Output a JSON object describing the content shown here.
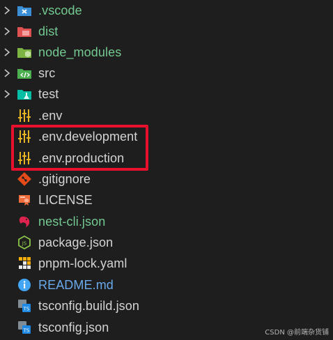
{
  "explorer": {
    "items": [
      {
        "label": "vscode",
        "prefix": ".",
        "kind": "folder",
        "icon": "vscode-folder-icon",
        "color": "#73c991"
      },
      {
        "label": "dist",
        "kind": "folder",
        "icon": "dist-folder-icon",
        "color": "#73c991"
      },
      {
        "label": "node_modules",
        "kind": "folder",
        "icon": "node-modules-folder-icon",
        "color": "#73c991"
      },
      {
        "label": "src",
        "kind": "folder",
        "icon": "src-folder-icon",
        "color": "#d4d4d4"
      },
      {
        "label": "test",
        "kind": "folder",
        "icon": "test-folder-icon",
        "color": "#d4d4d4"
      },
      {
        "label": ".env",
        "kind": "file",
        "icon": "env-settings-icon",
        "color": "#d4d4d4"
      },
      {
        "label": ".env.development",
        "kind": "file",
        "icon": "env-settings-icon",
        "color": "#d4d4d4"
      },
      {
        "label": ".env.production",
        "kind": "file",
        "icon": "env-settings-icon",
        "color": "#d4d4d4"
      },
      {
        "label": ".gitignore",
        "kind": "file",
        "icon": "git-icon",
        "color": "#d4d4d4"
      },
      {
        "label": "LICENSE",
        "kind": "file",
        "icon": "license-icon",
        "color": "#d4d4d4"
      },
      {
        "label": "nest-cli.json",
        "kind": "file",
        "icon": "nestjs-icon",
        "color": "#73c991"
      },
      {
        "label": "package.json",
        "kind": "file",
        "icon": "nodejs-icon",
        "color": "#d4d4d4"
      },
      {
        "label": "pnpm-lock.yaml",
        "kind": "file",
        "icon": "pnpm-icon",
        "color": "#d4d4d4"
      },
      {
        "label": "README.md",
        "kind": "file",
        "icon": "info-icon",
        "color": "#6aa9ea"
      },
      {
        "label": "tsconfig.build.json",
        "kind": "file",
        "icon": "tsconfig-icon",
        "color": "#d4d4d4"
      },
      {
        "label": "tsconfig.json",
        "kind": "file",
        "icon": "tsconfig-icon",
        "color": "#d4d4d4"
      }
    ]
  },
  "watermark": "CSDN @前端杂货铺"
}
